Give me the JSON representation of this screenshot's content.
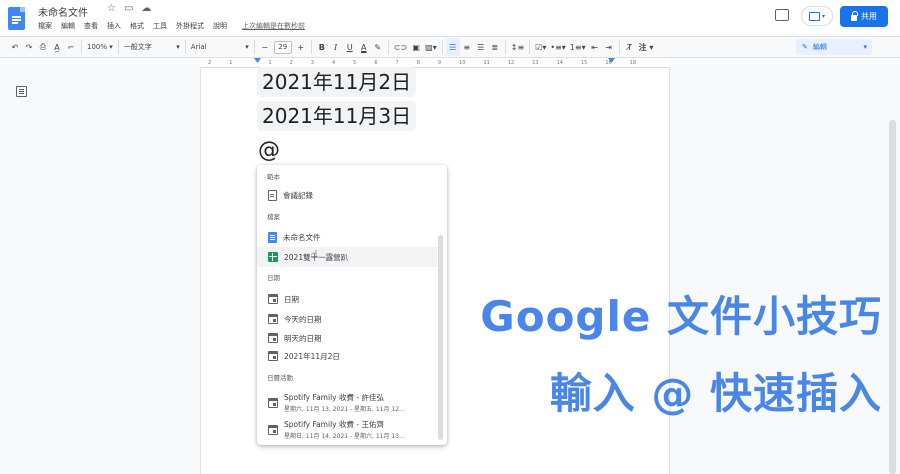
{
  "app": {
    "doc_title": "未命名文件",
    "menu": [
      "檔案",
      "編輯",
      "查看",
      "插入",
      "格式",
      "工具",
      "外掛程式",
      "說明"
    ],
    "last_edit": "上次編輯是在數秒前",
    "share_label": "共用",
    "present_caret": "▾"
  },
  "toolbar": {
    "zoom": "100%",
    "style": "一般文字",
    "font": "Arial",
    "font_size": "29",
    "mode": "編輯"
  },
  "ruler": {
    "labels": [
      "2",
      "1",
      "",
      "1",
      "2",
      "3",
      "4",
      "5",
      "6",
      "7",
      "8",
      "9",
      "10",
      "11",
      "12",
      "13",
      "14",
      "15",
      "16",
      "18"
    ]
  },
  "document": {
    "chips": [
      "2021年11月2日",
      "2021年11月3日"
    ],
    "at_symbol": "@"
  },
  "popup": {
    "sections": {
      "templates": "範本",
      "files": "檔案",
      "dates": "日期",
      "calendar": "日曆活動"
    },
    "items": {
      "meeting_notes": "會議記錄",
      "untitled_doc": "未命名文件",
      "sheet_file": "2021雙十一露營趴",
      "date": "日期",
      "today": "今天的日期",
      "tomorrow": "明天的日期",
      "date_value": "2021年11月2日"
    },
    "events": [
      {
        "title": "Spotify Family 收費 - 許佳弘",
        "sub": "星期六, 11月 13, 2021 - 星期五, 11月 12..."
      },
      {
        "title": "Spotify Family 收費 - 王佑齊",
        "sub": "星期日, 11月 14, 2021 - 星期六, 11月 13..."
      }
    ]
  },
  "overlay": {
    "line1": "Google 文件小技巧",
    "line2": "輸入 @ 快速插入"
  },
  "colors": {
    "accent": "#1a73e8",
    "overlay_text": "#4a86e8",
    "sheets_green": "#0f9d58"
  }
}
